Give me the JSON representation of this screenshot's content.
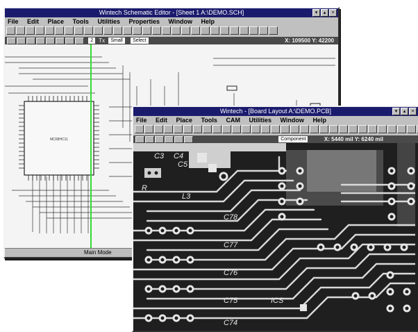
{
  "schematic": {
    "title": "Wintech Schematic Editor - [Sheet 1 A:\\DEMO.SCH]",
    "menu": [
      "File",
      "Edit",
      "Place",
      "Tools",
      "Utilities",
      "Properties",
      "Window",
      "Help"
    ],
    "options": {
      "size_value": "2",
      "text_label": "Tx",
      "text_size": "Small",
      "select_label": "Select",
      "coords": "X: 109500  Y: 42200"
    },
    "chip_label": "MC68HC11",
    "status": "Main Mode"
  },
  "pcb": {
    "title": "Wintech - [Board Layout A:\\DEMO.PCB]",
    "menu": [
      "File",
      "Edit",
      "Place",
      "Tools",
      "CAM",
      "Utilities",
      "Window",
      "Help"
    ],
    "options": {
      "layer": "Component",
      "coords": "X: 5440 mil  Y: 6240 mil"
    },
    "labels": [
      "C3",
      "C4",
      "C5",
      "R",
      "L3",
      "C78",
      "C77",
      "C76",
      "C75",
      "C74",
      "ICS"
    ]
  },
  "colors": {
    "title_bar": "#1b1b6e",
    "pcb_bg": "#1f1f1f",
    "trace": "#d9d9d9",
    "schematic_trace": "#222222",
    "highlight": "#33dd33"
  }
}
